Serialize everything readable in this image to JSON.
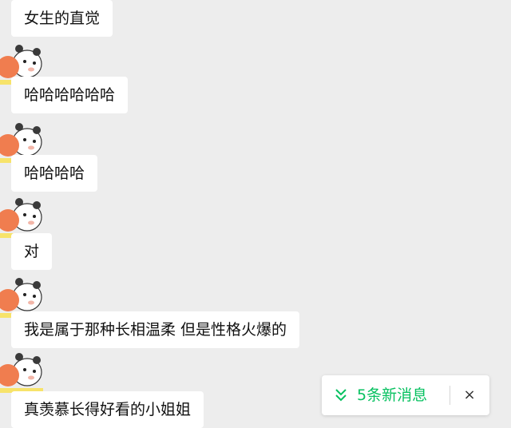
{
  "messages": [
    {
      "text": "女生的直觉"
    },
    {
      "text": "哈哈哈哈哈哈"
    },
    {
      "text": "哈哈哈哈"
    },
    {
      "text": "对"
    },
    {
      "text": "我是属于那种长相温柔 但是性格火爆的"
    },
    {
      "text": "真羡慕长得好看的小姐姐"
    }
  ],
  "toast": {
    "label": "5条新消息",
    "close_glyph": "×",
    "accent": "#07c160",
    "icon": "double-chevron-down-icon"
  },
  "avatar": {
    "icon": "panda-bear-sticker-icon"
  }
}
